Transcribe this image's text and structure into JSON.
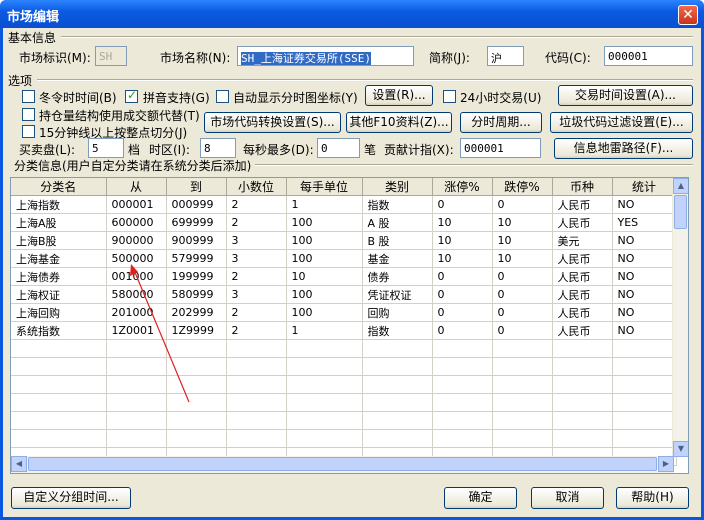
{
  "window": {
    "title": "市场编辑",
    "close": "✕"
  },
  "basic": {
    "section": "基本信息",
    "market_id_label": "市场标识(M):",
    "market_id_value": "SH",
    "market_name_label": "市场名称(N):",
    "market_name_value": "SH_上海证券交易所(SSE)",
    "short_label": "简称(J):",
    "short_value": "沪",
    "code_label": "代码(C):",
    "code_value": "000001"
  },
  "options": {
    "section": "选项",
    "dst": {
      "label": "冬令时时间(B)",
      "checked": false
    },
    "pinyin": {
      "label": "拼音支持(G)",
      "checked": true
    },
    "auto_coord": {
      "label": "自动显示分时图坐标(Y)",
      "checked": false
    },
    "settings_btn": "设置(R)...",
    "trade24": {
      "label": "24小时交易(U)",
      "checked": false
    },
    "trade_time_btn": "交易时间设置(A)...",
    "position_struct": {
      "label": "持仓量结构使用成交额代替(T)",
      "checked": false
    },
    "code_convert_btn": "市场代码转换设置(S)...",
    "f10_btn": "其他F10资料(Z)...",
    "period_btn": "分时周期...",
    "garbage_filter_btn": "垃圾代码过滤设置(E)...",
    "min15": {
      "label": "15分钟线以上按整点切分(J)",
      "checked": false
    },
    "depth_label": "买卖盘(L):",
    "depth_value": "5",
    "depth_unit": "档",
    "tz_label": "时区(I):",
    "tz_value": "8",
    "max_label": "每秒最多(D):",
    "max_value": "0",
    "max_unit": "笔",
    "contrib_label": "贡献计指(X):",
    "contrib_value": "000001",
    "mine_path_btn": "信息地雷路径(F)..."
  },
  "classify": {
    "section": "分类信息(用户自定分类请在系统分类后添加)",
    "columns": [
      "分类名",
      "从",
      "到",
      "小数位",
      "每手单位",
      "类别",
      "涨停%",
      "跌停%",
      "币种",
      "统计"
    ],
    "rows": [
      [
        "上海指数",
        "000001",
        "000999",
        "2",
        "1",
        "指数",
        "0",
        "0",
        "人民币",
        "NO"
      ],
      [
        "上海A股",
        "600000",
        "699999",
        "2",
        "100",
        "A 股",
        "10",
        "10",
        "人民币",
        "YES"
      ],
      [
        "上海B股",
        "900000",
        "900999",
        "3",
        "100",
        "B 股",
        "10",
        "10",
        "美元",
        "NO"
      ],
      [
        "上海基金",
        "500000",
        "579999",
        "3",
        "100",
        "基金",
        "10",
        "10",
        "人民币",
        "NO"
      ],
      [
        "上海债券",
        "001000",
        "199999",
        "2",
        "10",
        "债券",
        "0",
        "0",
        "人民币",
        "NO"
      ],
      [
        "上海权证",
        "580000",
        "580999",
        "3",
        "100",
        "凭证权证",
        "0",
        "0",
        "人民币",
        "NO"
      ],
      [
        "上海回购",
        "201000",
        "202999",
        "2",
        "100",
        "回购",
        "0",
        "0",
        "人民币",
        "NO"
      ],
      [
        "系统指数",
        "1Z0001",
        "1Z9999",
        "2",
        "1",
        "指数",
        "0",
        "0",
        "人民币",
        "NO"
      ]
    ]
  },
  "footer": {
    "custom_time_btn": "自定义分组时间...",
    "ok_btn": "确定",
    "cancel_btn": "取消",
    "help_btn": "帮助(H)"
  },
  "colors": {
    "annotation_arrow": "#e02020",
    "title_bar": "#0b5be2"
  }
}
